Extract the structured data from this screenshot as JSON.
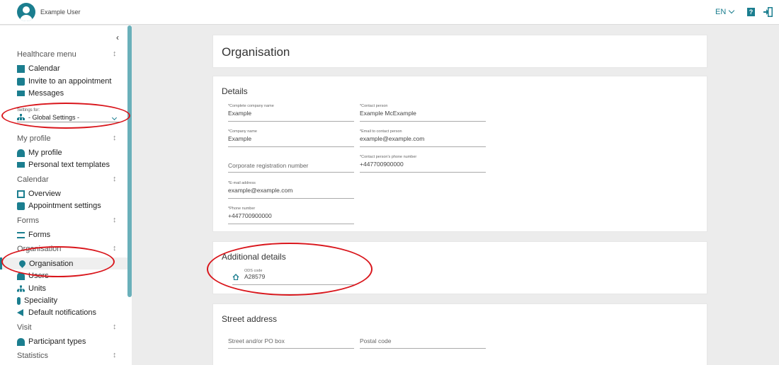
{
  "header": {
    "username": "Example User",
    "language": "EN"
  },
  "sidebar": {
    "sections": {
      "healthcare": "Healthcare menu",
      "my_profile": "My profile",
      "calendar": "Calendar",
      "forms": "Forms",
      "organisation": "Organisation",
      "visit": "Visit",
      "statistics": "Statistics"
    },
    "items": {
      "calendar": "Calendar",
      "invite": "Invite to an appointment",
      "messages": "Messages",
      "my_profile": "My profile",
      "personal_text": "Personal text templates",
      "overview": "Overview",
      "appointment_settings": "Appointment settings",
      "forms": "Forms",
      "organisation": "Organisation",
      "users": "Users",
      "units": "Units",
      "speciality": "Speciality",
      "default_notifications": "Default notifications",
      "participant_types": "Participant types"
    },
    "settings_for": {
      "label": "Settings for:",
      "value": "- Global Settings -"
    }
  },
  "main": {
    "page_title": "Organisation",
    "details": {
      "title": "Details",
      "fields": {
        "company_full": {
          "label": "*Complete company name",
          "value": "Example"
        },
        "contact_person": {
          "label": "*Contact person",
          "value": "Example McExample"
        },
        "company_name": {
          "label": "*Company name",
          "value": "Example"
        },
        "contact_email": {
          "label": "*Email to contact person",
          "value": "example@example.com"
        },
        "registration": {
          "label": "",
          "value": "Corporate registration number"
        },
        "contact_phone": {
          "label": "*Contact person's phone number",
          "value": "+447700900000"
        },
        "email": {
          "label": "*E-mail address",
          "value": "example@example.com"
        },
        "phone": {
          "label": "*Phone number",
          "value": "+447700900000"
        }
      }
    },
    "additional": {
      "title": "Additional details",
      "ods": {
        "label": "ODS code",
        "value": "A28579"
      }
    },
    "street": {
      "title": "Street address",
      "street_placeholder": "Street and/or PO box",
      "postal_placeholder": "Postal code"
    }
  },
  "colors": {
    "accent": "#1b7e8f",
    "annotation": "#d9161c",
    "background": "#ececec"
  }
}
